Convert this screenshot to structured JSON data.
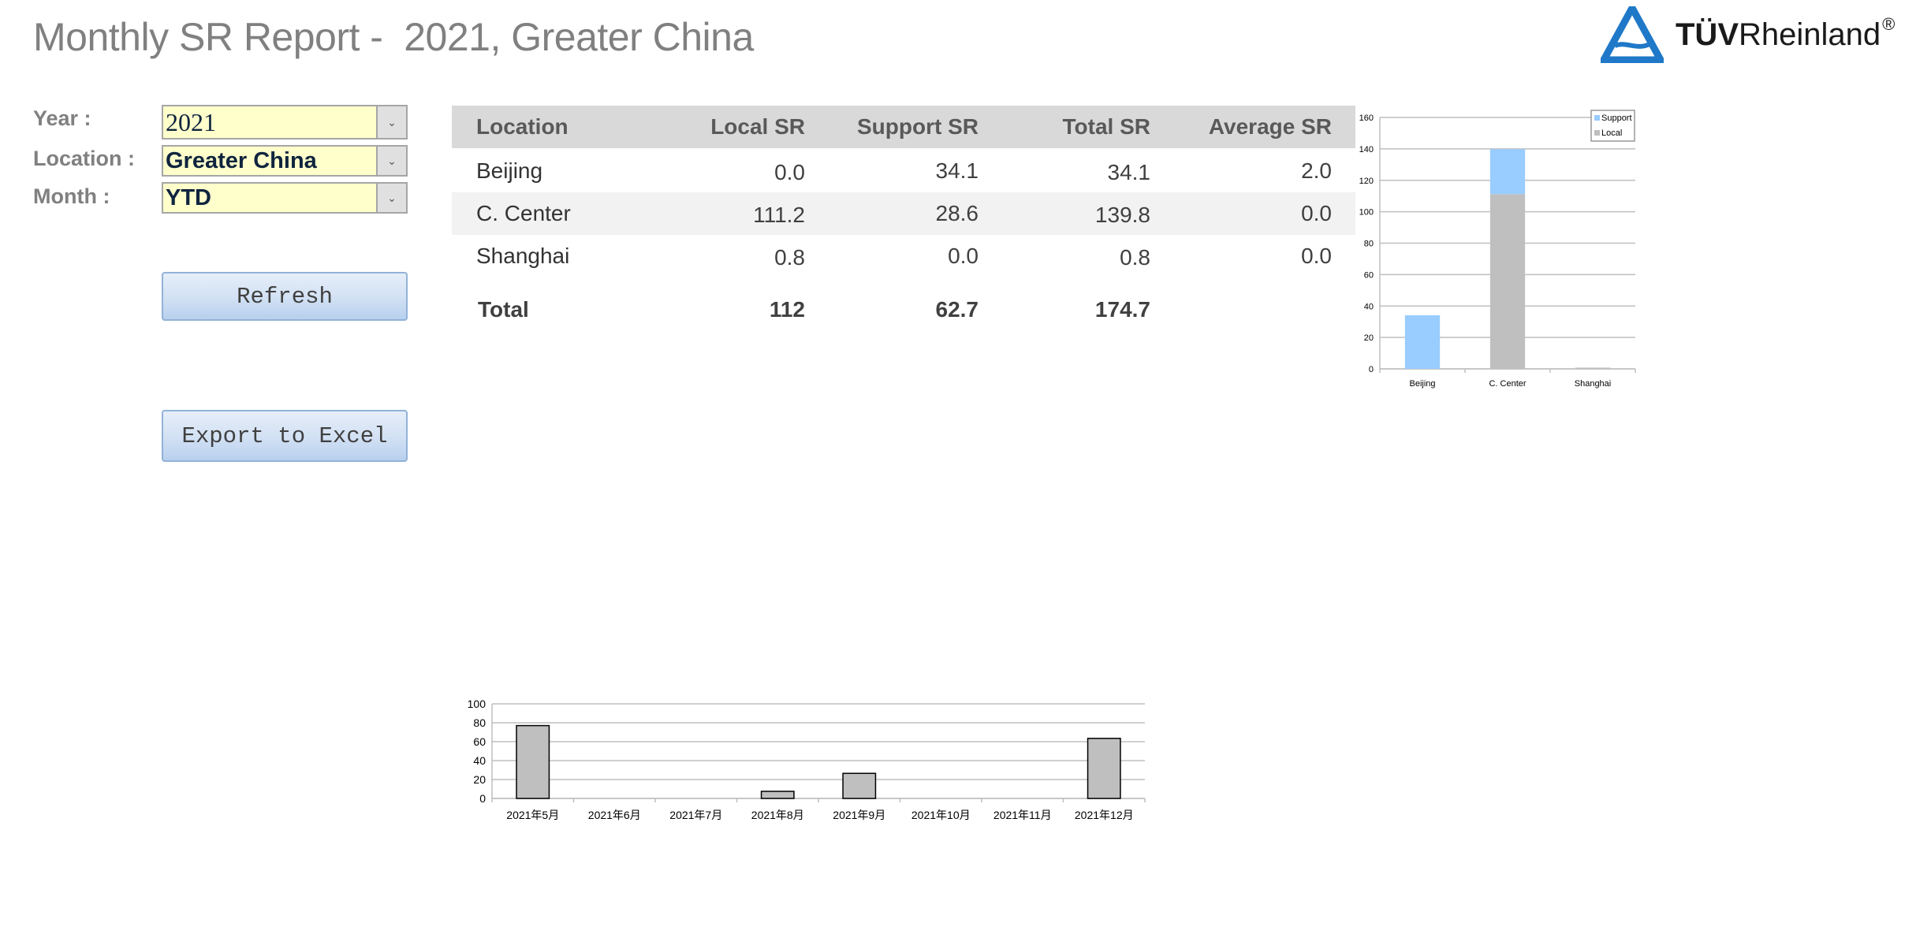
{
  "header": {
    "title": "Monthly SR Report -  2021, Greater China",
    "logo": {
      "brand_bold": "TÜV",
      "brand_regular": "Rheinland",
      "registered": "®",
      "icon": "tuv-triangle-logo-icon",
      "color": "#1f78c8"
    }
  },
  "filters": {
    "year": {
      "label": "Year :",
      "value": "2021"
    },
    "location": {
      "label": "Location :",
      "value": "Greater China"
    },
    "month": {
      "label": "Month :",
      "value": "YTD"
    },
    "dropdown_icon": "chevron-down-icon",
    "field_bg": "#ffffcc"
  },
  "actions": {
    "refresh_label": "Refresh",
    "export_label": "Export to Excel"
  },
  "table": {
    "columns": [
      "Location",
      "Local SR",
      "Support SR",
      "Total SR",
      "Average SR"
    ],
    "rows": [
      {
        "location": "Beijing",
        "local": "0.0",
        "support": "34.1",
        "total": "34.1",
        "average": "2.0"
      },
      {
        "location": "C. Center",
        "local": "111.2",
        "support": "28.6",
        "total": "139.8",
        "average": "0.0"
      },
      {
        "location": "Shanghai",
        "local": "0.8",
        "support": "0.0",
        "total": "0.8",
        "average": "0.0"
      }
    ],
    "total": {
      "label": "Total",
      "local": "112",
      "support": "62.7",
      "total": "174.7",
      "average": ""
    }
  },
  "chart_data": [
    {
      "type": "bar",
      "stacked": true,
      "title": "",
      "xlabel": "",
      "ylabel": "",
      "categories": [
        "Beijing",
        "C. Center",
        "Shanghai"
      ],
      "series": [
        {
          "name": "Local",
          "values": [
            0.0,
            111.2,
            0.8
          ],
          "color": "#bfbfbf"
        },
        {
          "name": "Support",
          "values": [
            34.1,
            28.6,
            0.0
          ],
          "color": "#99ccff"
        }
      ],
      "legend": [
        "Support",
        "Local"
      ],
      "legend_position": "top-right",
      "ylim": [
        0,
        160
      ],
      "yticks": [
        0,
        20,
        40,
        60,
        80,
        100,
        120,
        140,
        160
      ],
      "grid": true
    },
    {
      "type": "bar",
      "title": "",
      "xlabel": "",
      "ylabel": "",
      "categories": [
        "2021年5月",
        "2021年6月",
        "2021年7月",
        "2021年8月",
        "2021年9月",
        "2021年10月",
        "2021年11月",
        "2021年12月"
      ],
      "values": [
        77,
        0,
        0,
        7.5,
        26.5,
        0,
        0,
        63.5
      ],
      "color": "#bfbfbf",
      "ylim": [
        0,
        100
      ],
      "yticks": [
        0,
        20,
        40,
        60,
        80,
        100
      ],
      "grid": true,
      "legend": []
    }
  ]
}
